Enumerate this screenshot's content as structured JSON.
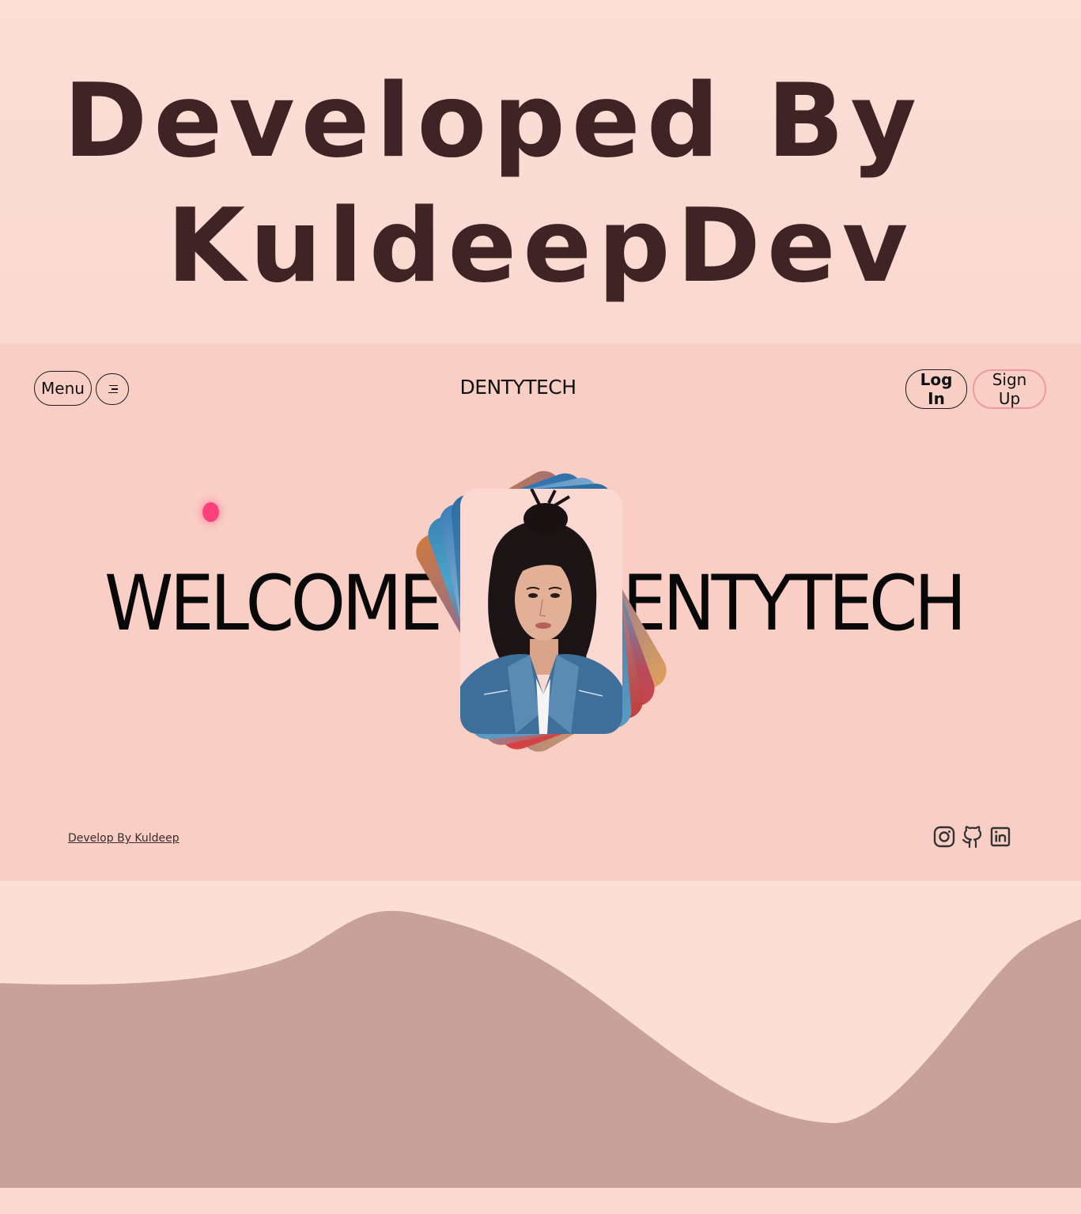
{
  "banner": {
    "line1": "Developed By",
    "line2": "KuldeepDev"
  },
  "nav": {
    "menu_label": "Menu",
    "brand": "DENTYTECH",
    "login_label": "Log In",
    "signup_label": "Sign Up"
  },
  "hero": {
    "left_text": "WELCOME",
    "right_text": "ENTYTECH"
  },
  "footer": {
    "credit_link": "Develop By Kuldeep",
    "social_icons": [
      "instagram-icon",
      "github-icon",
      "linkedin-icon"
    ]
  },
  "colors": {
    "accent_dot": "#ff3f7e",
    "banner_text": "#3f2325",
    "app_bg": "#f9cfc5",
    "wave": "#c7a19a",
    "signup_border": "#ef9aa0"
  }
}
